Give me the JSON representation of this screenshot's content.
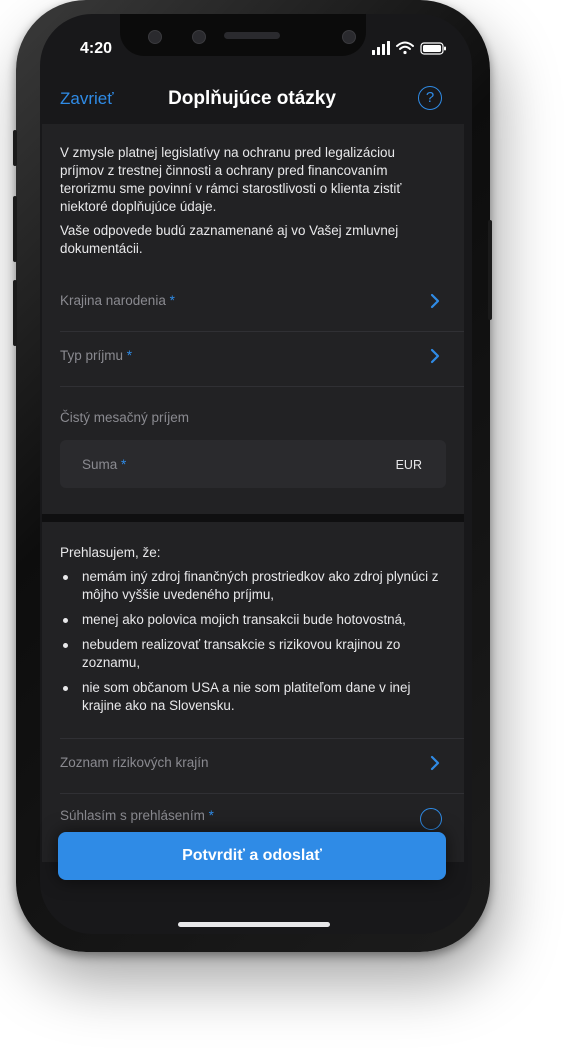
{
  "status": {
    "time": "4:20"
  },
  "header": {
    "close_label": "Zavrieť",
    "title": "Doplňujúce otázky",
    "help_label": "?"
  },
  "intro": {
    "paragraph1": "V zmysle platnej legislatívy na ochranu pred legalizáciou príjmov z trestnej činnosti a ochrany pred financovaním terorizmu sme povinní v rámci starostlivosti o klienta zistiť niektoré doplňujúce údaje.",
    "paragraph2": "Vaše odpovede budú zaznamenané aj vo Vašej zmluvnej dokumentácii."
  },
  "fields": {
    "nationality": {
      "label": "Krajina narodenia",
      "required_mark": " *"
    },
    "income_type": {
      "label": "Typ príjmu",
      "required_mark": " *"
    },
    "net_income_label": "Čistý mesačný príjem",
    "amount": {
      "placeholder": "Suma",
      "required_mark": " *",
      "currency": "EUR"
    }
  },
  "declaration": {
    "heading": "Prehlasujem, že:",
    "items": [
      "nemám iný zdroj finančných prostriedkov ako zdroj plynúci z môjho vyššie uvedeného príjmu,",
      "menej ako polovica mojich transakcii bude hotovostná,",
      "nebudem realizovať transakcie s rizikovou krajinou zo zoznamu,",
      "nie som občanom USA a nie som platiteľom dane v inej krajine ako na Slovensku."
    ],
    "risky_countries_label": "Zoznam rizikových krajín",
    "consent": {
      "label": "Súhlasím s prehlásením",
      "required_mark": " *"
    }
  },
  "submit_label": "Potvrdiť a odoslať",
  "colors": {
    "accent": "#2f8be6",
    "background": "#18181a",
    "card": "#222224",
    "muted_text": "#8a8a90"
  },
  "icons": [
    "signal-icon",
    "wifi-icon",
    "battery-icon",
    "help-icon",
    "chevron-right-icon",
    "radio-icon"
  ]
}
